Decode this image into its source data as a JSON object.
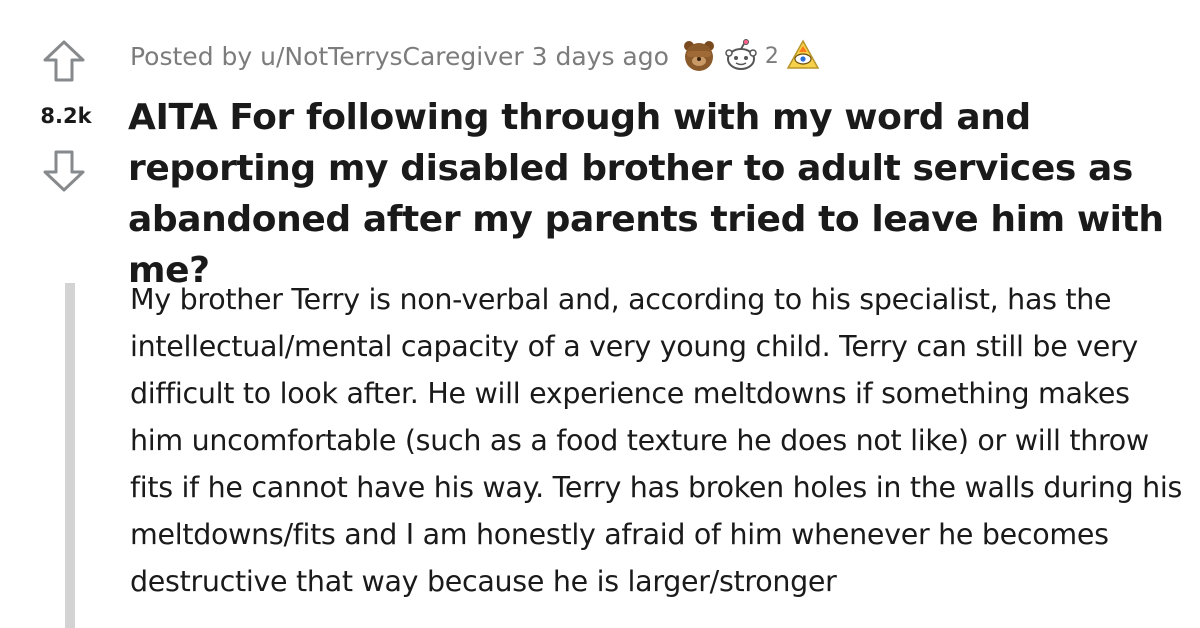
{
  "vote": {
    "count": "8.2k",
    "upvote_icon": "upvote-arrow-icon",
    "downvote_icon": "downvote-arrow-icon"
  },
  "meta": {
    "posted_by": "Posted by u/NotTerrysCaregiver 3 days ago",
    "awards": [
      {
        "icon": "facepalm-bear-award-icon"
      },
      {
        "icon": "wholesome-award-icon",
        "count": "2"
      },
      {
        "icon": "all-seeing-upvote-award-icon"
      }
    ]
  },
  "post": {
    "title": "AITA For following through with my word and reporting my disabled brother to adult services as abandoned after my parents tried to leave him with me?",
    "body": "My brother Terry is non-verbal and, according to his specialist, has the intellectual/mental capacity of a very young child. Terry can still be very difficult to look after. He will experience meltdowns if something makes him uncomfortable (such as a food texture he does not like) or will throw fits if he cannot have his way. Terry has broken holes in the walls during his meltdowns/fits and I am honestly afraid of him whenever he becomes destructive that way because he is larger/stronger"
  }
}
